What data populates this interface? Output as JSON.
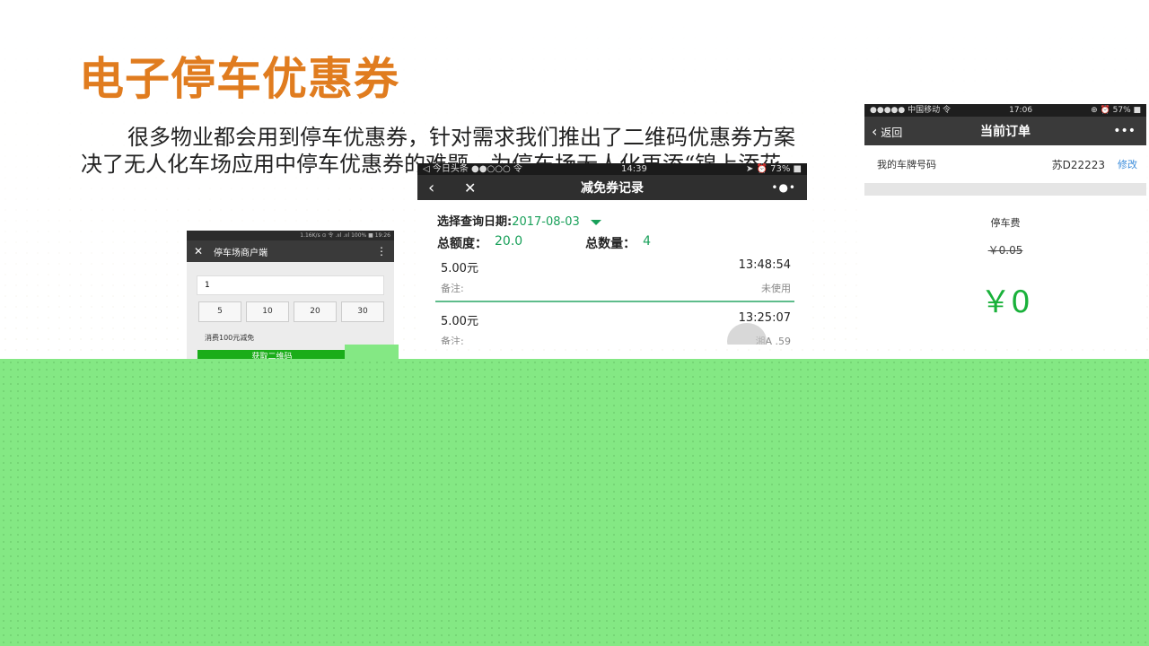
{
  "title": "电子停车优惠券",
  "paragraph": {
    "line1": "很多物业都会用到停车优惠券，针对需求我们推出了二维码优惠券方案",
    "line2": "决了无人化车场应用中停车优惠券的难题，为停车场无人化再添“锦上添花"
  },
  "merchant_phone": {
    "status": "1.16K/s ⊙ 令 .ııl .ııl 100% ■ 19:26",
    "close_icon": "close-icon",
    "title": "停车场商户端",
    "menu_icon": "vertical-dots-icon",
    "input_value": "1",
    "amounts": [
      "5",
      "10",
      "20",
      "30"
    ],
    "hint": "消费100元减免",
    "get_button": "获取二维码"
  },
  "records_phone": {
    "status_left": "◁ 今日头条 ●●○○○ 令",
    "status_time": "14:39",
    "status_right": "➤ ⏰ 73% ■",
    "title": "减免券记录",
    "date_label": "选择查询日期:",
    "date_value": "2017-08-03",
    "total_amount_label": "总额度：",
    "total_amount": "20.0",
    "total_count_label": "总数量：",
    "total_count": "4",
    "records": [
      {
        "amount": "5.00元",
        "time": "13:48:54",
        "note_label": "备注:",
        "status": "未使用"
      },
      {
        "amount": "5.00元",
        "time": "13:25:07",
        "note_label": "备注:",
        "status": "湘A    .59"
      }
    ]
  },
  "order_phone": {
    "status_left": "●●●●● 中国移动 令",
    "status_time": "17:06",
    "status_right": "⊕ ⏰ 57% ■",
    "back_label": "返回",
    "title": "当前订单",
    "more": "•••",
    "plate_label": "我的车牌号码",
    "plate_number": "苏D22223",
    "edit_label": "修改",
    "fee_label": "停车费",
    "fee_original": "￥0.05",
    "fee_final": "￥0"
  },
  "colors": {
    "title": "#e07c1f",
    "accent_green": "#19a05a",
    "band_green": "#84e884"
  }
}
